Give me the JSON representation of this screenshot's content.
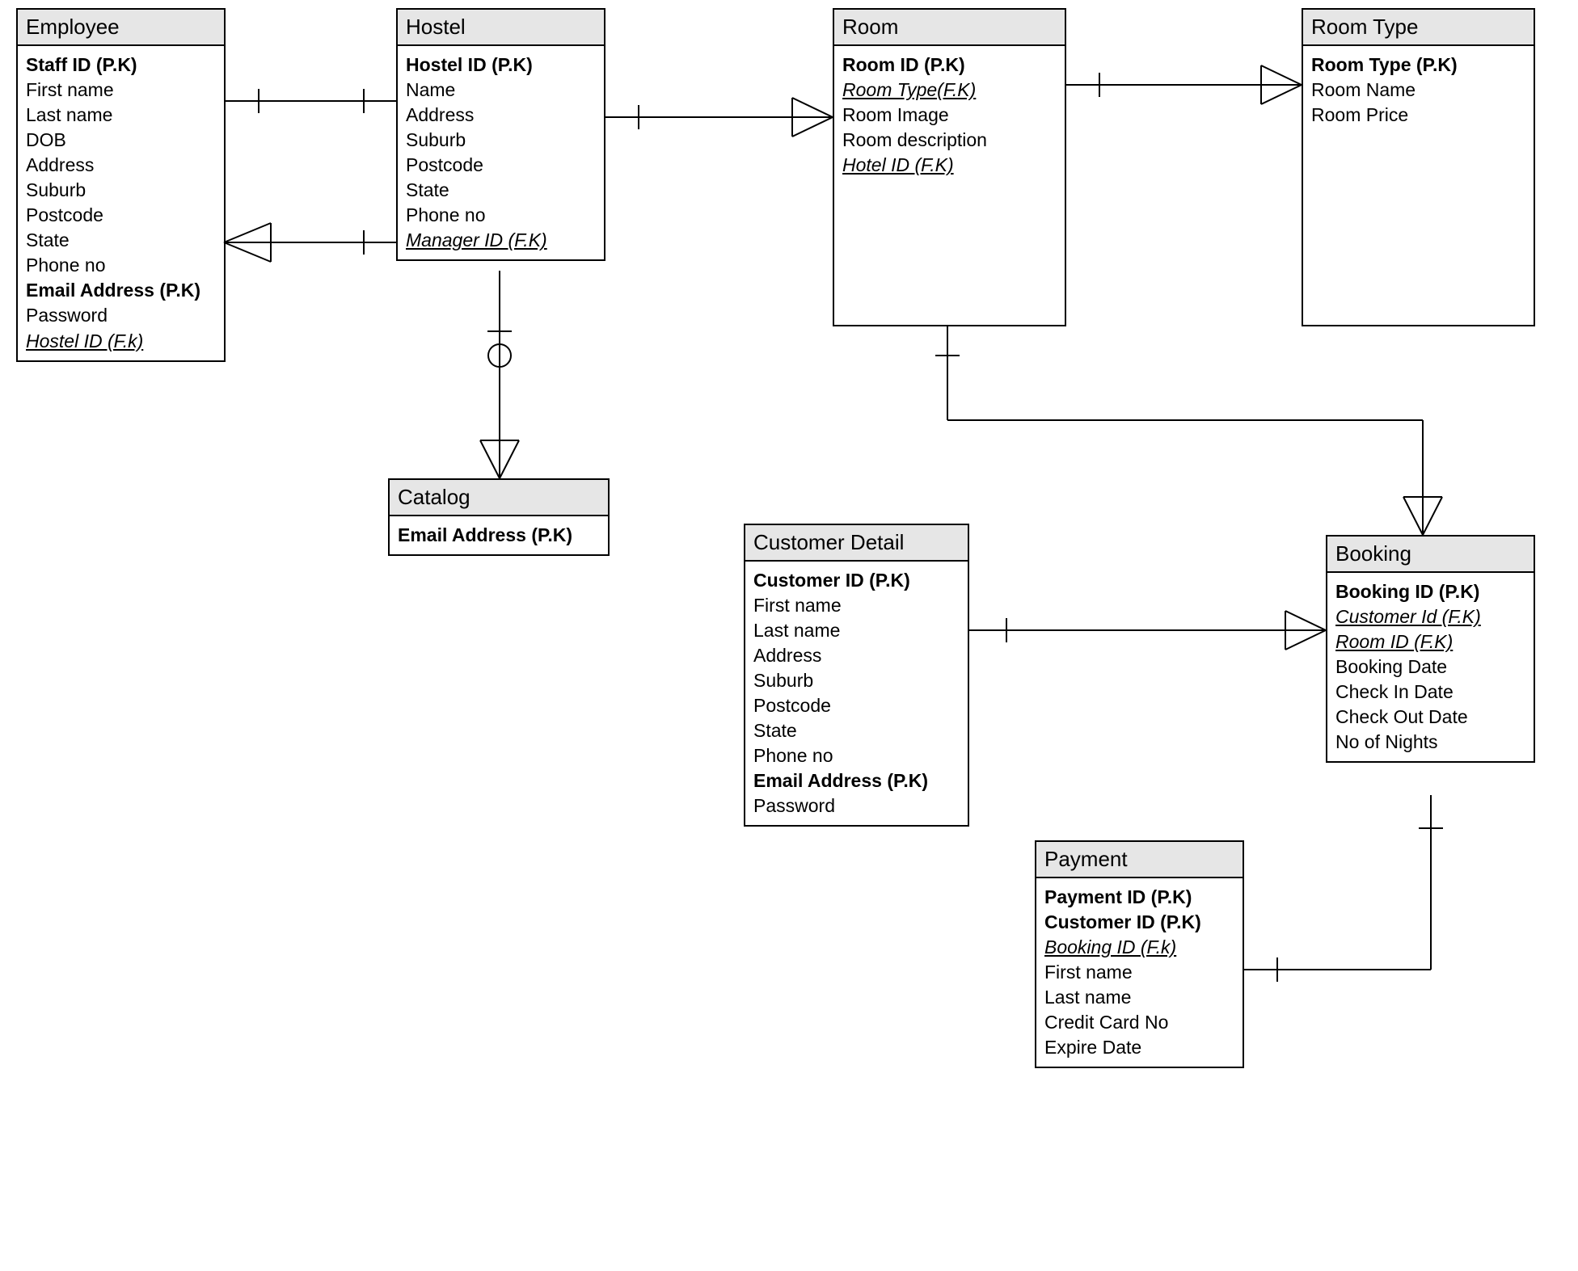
{
  "entities": {
    "employee": {
      "title": "Employee",
      "attrs": [
        {
          "text": "Staff ID (P.K)",
          "pk": true
        },
        {
          "text": "First name"
        },
        {
          "text": "Last name"
        },
        {
          "text": "DOB"
        },
        {
          "text": "Address"
        },
        {
          "text": "Suburb"
        },
        {
          "text": "Postcode"
        },
        {
          "text": "State"
        },
        {
          "text": "Phone no"
        },
        {
          "text": "Email Address (P.K)",
          "pk": true
        },
        {
          "text": "Password"
        },
        {
          "text": "Hostel ID (F.k)",
          "fk": true
        }
      ]
    },
    "hostel": {
      "title": "Hostel",
      "attrs": [
        {
          "text": "Hostel ID (P.K)",
          "pk": true
        },
        {
          "text": "Name"
        },
        {
          "text": "Address"
        },
        {
          "text": "Suburb"
        },
        {
          "text": "Postcode"
        },
        {
          "text": "State"
        },
        {
          "text": "Phone no"
        },
        {
          "text": "Manager ID (F.K)",
          "fk": true
        }
      ]
    },
    "catalog": {
      "title": "Catalog",
      "attrs": [
        {
          "text": "Email Address (P.K)",
          "pk": true
        }
      ]
    },
    "room": {
      "title": "Room",
      "attrs": [
        {
          "text": "Room ID (P.K)",
          "pk": true
        },
        {
          "text": "Room Type(F.K)",
          "fk": true
        },
        {
          "text": "Room Image"
        },
        {
          "text": "Room description"
        },
        {
          "text": "Hotel  ID (F.K)",
          "fk": true
        }
      ]
    },
    "roomtype": {
      "title": "Room Type",
      "attrs": [
        {
          "text": "Room Type (P.K)",
          "pk": true
        },
        {
          "text": "Room Name"
        },
        {
          "text": "Room Price"
        }
      ]
    },
    "customer": {
      "title": "Customer Detail",
      "attrs": [
        {
          "text": "Customer ID (P.K)",
          "pk": true
        },
        {
          "text": "First name"
        },
        {
          "text": "Last name"
        },
        {
          "text": "Address"
        },
        {
          "text": "Suburb"
        },
        {
          "text": "Postcode"
        },
        {
          "text": "State"
        },
        {
          "text": "Phone no"
        },
        {
          "text": "Email Address (P.K)",
          "pk": true
        },
        {
          "text": "Password"
        }
      ]
    },
    "booking": {
      "title": "Booking",
      "attrs": [
        {
          "text": "Booking ID (P.K)",
          "pk": true
        },
        {
          "text": "Customer Id (F.K)",
          "fk": true
        },
        {
          "text": "Room ID (F.K)",
          "fk": true
        },
        {
          "text": "Booking Date"
        },
        {
          "text": "Check In Date"
        },
        {
          "text": "Check Out Date"
        },
        {
          "text": "No of Nights"
        }
      ]
    },
    "payment": {
      "title": "Payment",
      "attrs": [
        {
          "text": "Payment ID (P.K)",
          "pk": true
        },
        {
          "text": "Customer ID (P.K)",
          "pk": true
        },
        {
          "text": "Booking ID (F.k)",
          "fk": true
        },
        {
          "text": "First name"
        },
        {
          "text": "Last name"
        },
        {
          "text": "Credit Card No"
        },
        {
          "text": "Expire Date"
        }
      ]
    }
  }
}
